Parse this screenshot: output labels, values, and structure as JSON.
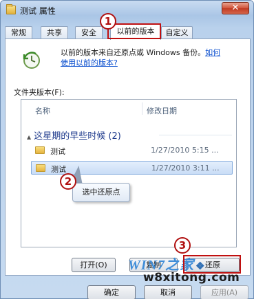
{
  "window": {
    "title": "测试 属性",
    "close_glyph": "✕"
  },
  "tabs": [
    {
      "label": "常规"
    },
    {
      "label": "共享"
    },
    {
      "label": "安全"
    },
    {
      "label": "以前的版本",
      "active": true
    },
    {
      "label": "自定义"
    }
  ],
  "panel": {
    "description": "以前的版本来自还原点或 Windows 备份。",
    "link_prefix": "如何",
    "link_text": "使用以前的版本?",
    "list_label": "文件夹版本(F):",
    "columns": {
      "name": "名称",
      "modified": "修改日期"
    },
    "group": {
      "label": "这星期的早些时候 (2)"
    },
    "rows": [
      {
        "name": "测试",
        "date": "1/27/2010 5:15 ...",
        "selected": false
      },
      {
        "name": "测试",
        "date": "1/27/2010 3:11 ...",
        "selected": true
      }
    ],
    "buttons": {
      "open": "打开(O)",
      "copy": "复制",
      "restore": "还原"
    }
  },
  "callout": {
    "text": "选中还原点"
  },
  "annotations": {
    "step1": "1",
    "step2": "2",
    "step3": "3"
  },
  "footer": {
    "ok": "确定",
    "cancel": "取消",
    "apply": "应用(A)"
  },
  "watermark": {
    "logo": "WIN7之家",
    "site": "w8xitong.com"
  },
  "colors": {
    "accent_red": "#c01010",
    "link": "#0b4fcf",
    "selection": "#c9ddf6"
  }
}
